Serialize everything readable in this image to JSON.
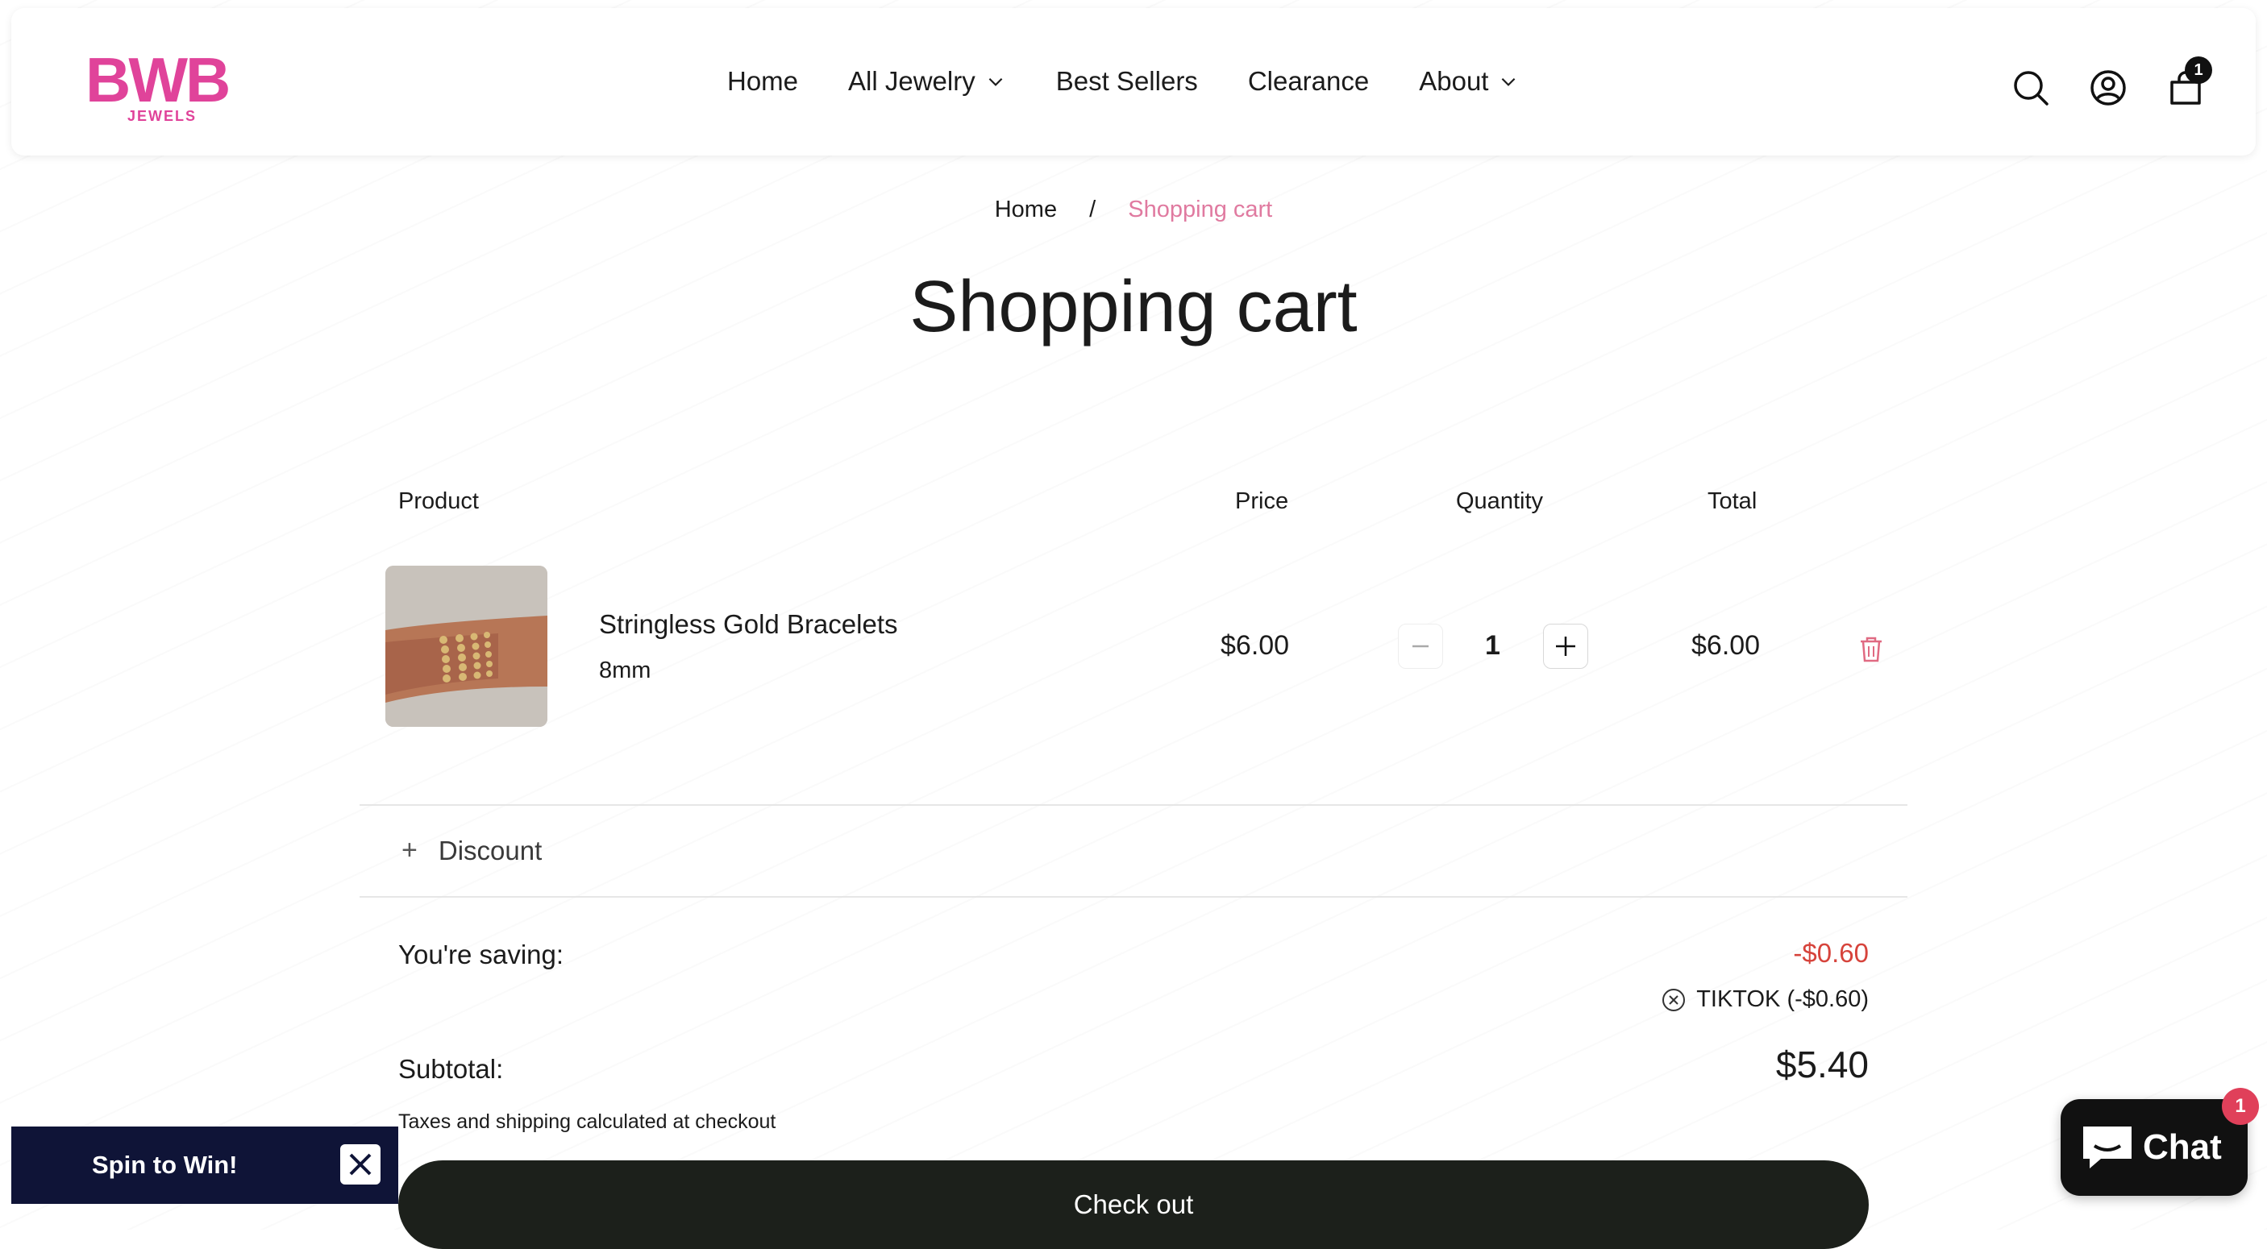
{
  "brand": {
    "logo_main": "BWB",
    "logo_sub": "JEWELS",
    "color": "#e0439a"
  },
  "nav": {
    "items": [
      {
        "label": "Home",
        "dropdown": false
      },
      {
        "label": "All Jewelry",
        "dropdown": true
      },
      {
        "label": "Best Sellers",
        "dropdown": false
      },
      {
        "label": "Clearance",
        "dropdown": false
      },
      {
        "label": "About",
        "dropdown": true
      }
    ]
  },
  "header_icons": {
    "search": "search-icon",
    "account": "account-icon",
    "cart": "cart-icon",
    "cart_count": "1"
  },
  "breadcrumb": {
    "home": "Home",
    "separator": "/",
    "current": "Shopping cart"
  },
  "page_title": "Shopping cart",
  "table": {
    "headers": {
      "product": "Product",
      "price": "Price",
      "quantity": "Quantity",
      "total": "Total"
    }
  },
  "cart_item": {
    "name": "Stringless Gold Bracelets",
    "variant": "8mm",
    "price": "$6.00",
    "quantity": "1",
    "total": "$6.00"
  },
  "discount": {
    "plus": "+",
    "label": "Discount"
  },
  "summary": {
    "saving_label": "You're saving:",
    "saving_value": "-$0.60",
    "code_text": "TIKTOK (-$0.60)",
    "subtotal_label": "Subtotal:",
    "subtotal_value": "$5.40",
    "tax_note": "Taxes and shipping calculated at checkout"
  },
  "checkout_label": "Check out",
  "spin_widget": {
    "label": "Spin to Win!"
  },
  "chat_widget": {
    "label": "Chat",
    "badge": "1"
  },
  "colors": {
    "accent_pink": "#e07aa0",
    "discount_red": "#d6433b",
    "checkout_bg": "#1c201b",
    "spin_bg": "#0f1437"
  }
}
